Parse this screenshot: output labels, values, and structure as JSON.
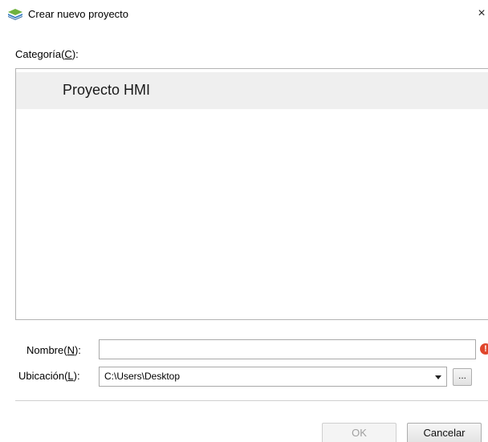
{
  "window": {
    "title": "Crear nuevo proyecto",
    "close_glyph": "×",
    "icon": "app-icon"
  },
  "category": {
    "label_prefix": "Categoría(",
    "label_key": "C",
    "label_suffix": "):",
    "items": [
      {
        "label": "Proyecto HMI",
        "selected": true
      }
    ]
  },
  "form": {
    "name": {
      "label_prefix": "Nombre(",
      "label_key": "N",
      "label_suffix": "):",
      "value": "",
      "error_glyph": "!"
    },
    "location": {
      "label_prefix": "Ubicación(",
      "label_key": "L",
      "label_suffix": "):",
      "value": "C:\\Users\\Desktop",
      "browse_label": "..."
    }
  },
  "buttons": {
    "ok_label": "OK",
    "cancel_label": "Cancelar"
  },
  "colors": {
    "selected_row": "#efefef",
    "error": "#e0462c"
  }
}
